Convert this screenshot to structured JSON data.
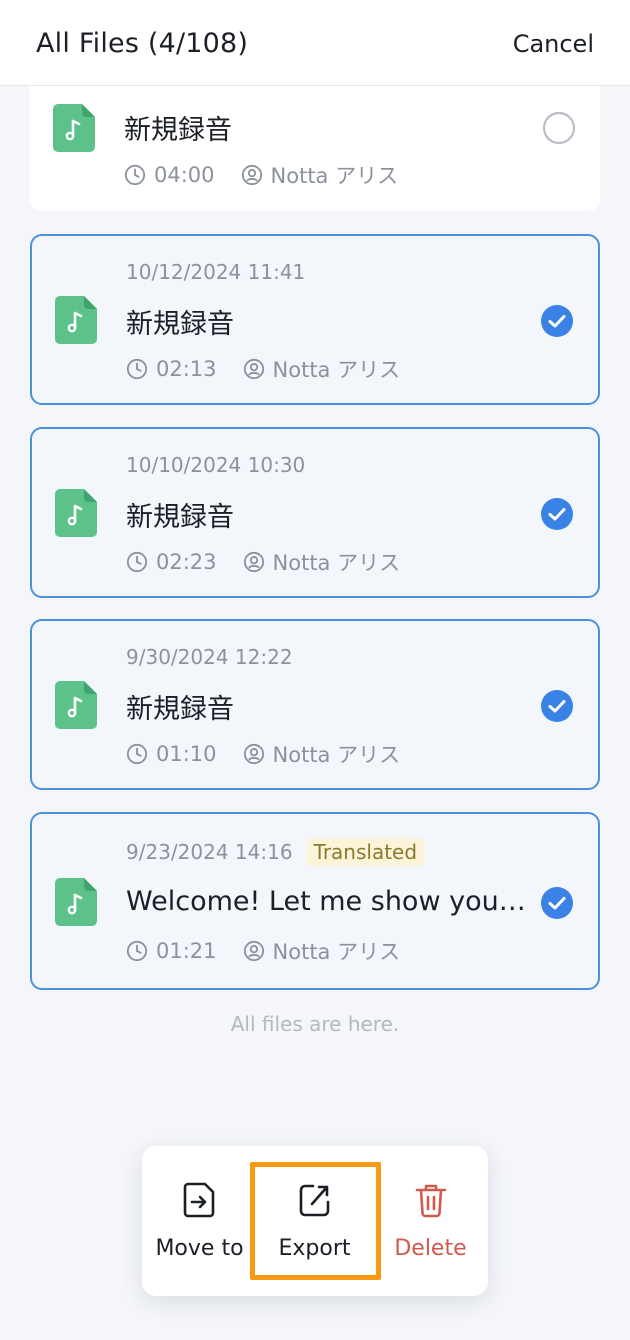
{
  "header": {
    "title": "All Files (4/108)",
    "cancel_label": "Cancel"
  },
  "files": [
    {
      "date": "",
      "name": "新規録音",
      "duration": "04:00",
      "owner": "Notta アリス",
      "selected": false,
      "badge": ""
    },
    {
      "date": "10/12/2024  11:41",
      "name": "新規録音",
      "duration": "02:13",
      "owner": "Notta アリス",
      "selected": true,
      "badge": ""
    },
    {
      "date": "10/10/2024  10:30",
      "name": "新規録音",
      "duration": "02:23",
      "owner": "Notta アリス",
      "selected": true,
      "badge": ""
    },
    {
      "date": "9/30/2024  12:22",
      "name": "新規録音",
      "duration": "01:10",
      "owner": "Notta アリス",
      "selected": true,
      "badge": ""
    },
    {
      "date": "9/23/2024  14:16",
      "name": "Welcome! Let me show you around",
      "duration": "01:21",
      "owner": "Notta アリス",
      "selected": true,
      "badge": "Translated"
    }
  ],
  "footer_note": "All files are here.",
  "actions": {
    "move_label": "Move to",
    "export_label": "Export",
    "delete_label": "Delete"
  },
  "colors": {
    "accent": "#3b82e6",
    "file_icon": "#5cc28a",
    "delete": "#d05a4c",
    "highlight": "#f59a12"
  },
  "icons": {
    "file": "audio-file-icon",
    "clock": "clock-icon",
    "user": "user-icon",
    "check": "check-circle-icon",
    "move": "move-to-icon",
    "export": "export-icon",
    "delete": "trash-icon"
  }
}
